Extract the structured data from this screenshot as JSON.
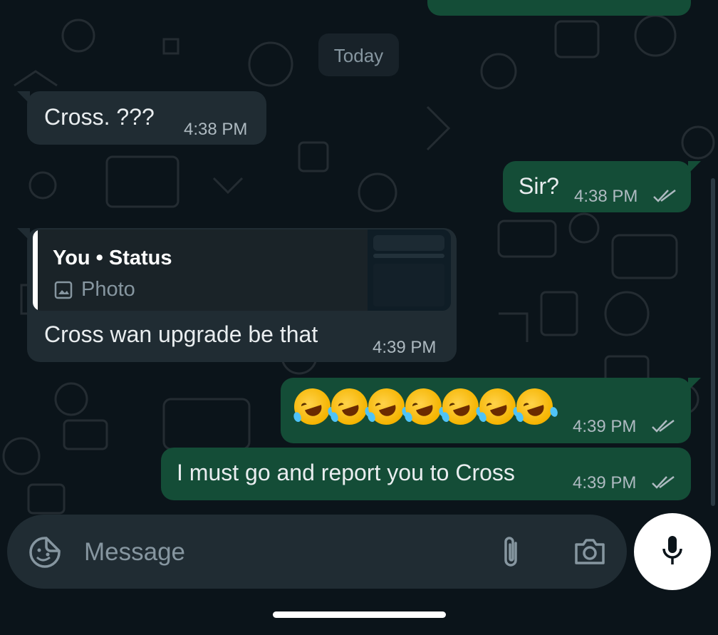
{
  "date_divider": "Today",
  "messages": [
    {
      "direction": "incoming",
      "text": "Cross. ???",
      "time": "4:38 PM"
    },
    {
      "direction": "outgoing",
      "text": "Sir?",
      "time": "4:38 PM",
      "status": "read"
    },
    {
      "direction": "incoming",
      "quote": {
        "title": "You • Status",
        "subtitle": "Photo",
        "icon": "image-icon"
      },
      "text": "Cross wan upgrade be that",
      "time": "4:39 PM"
    },
    {
      "direction": "outgoing",
      "text": "🤣🤣🤣🤣🤣🤣🤣",
      "time": "4:39 PM",
      "status": "read"
    },
    {
      "direction": "outgoing",
      "text": "I must go and report you to Cross",
      "time": "4:39 PM",
      "status": "read"
    }
  ],
  "composer": {
    "placeholder": "Message",
    "icons": [
      "sticker-icon",
      "paperclip-icon",
      "camera-icon",
      "mic-icon"
    ]
  },
  "colors": {
    "background": "#0b141a",
    "incoming_bubble": "#202c33",
    "outgoing_bubble": "#144d37",
    "text": "#e9edef",
    "meta": "#aebac1"
  }
}
